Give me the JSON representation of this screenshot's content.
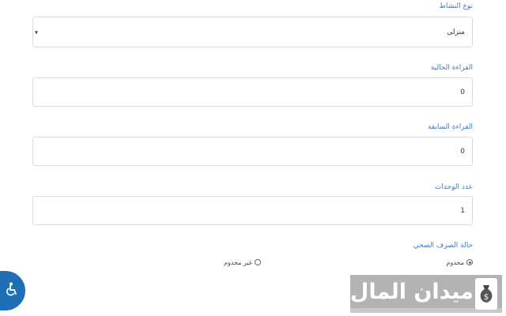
{
  "form": {
    "activity_type": {
      "label": "نوع النشاط",
      "value": "منزلى"
    },
    "current_reading": {
      "label": "القراءة الحالية",
      "value": "0"
    },
    "previous_reading": {
      "label": "القراءة السابقة",
      "value": "0"
    },
    "units": {
      "label": "عدد الوحدات",
      "value": "1"
    },
    "sanitation": {
      "label": "حالة الصرف الصحي",
      "options": [
        {
          "label": "مخدوم",
          "checked": true
        },
        {
          "label": "غير مخدوم",
          "checked": false
        }
      ]
    }
  },
  "brand": {
    "text": "ميدان المال"
  },
  "icons": {
    "accessibility": "wheelchair-icon",
    "select_caret": "chevron-down-icon",
    "brand_emblem": "money-bag-icon"
  },
  "colors": {
    "label": "#3e7bbf",
    "accent": "#1f6fb6",
    "brand_bg": "#b3b3b3"
  }
}
